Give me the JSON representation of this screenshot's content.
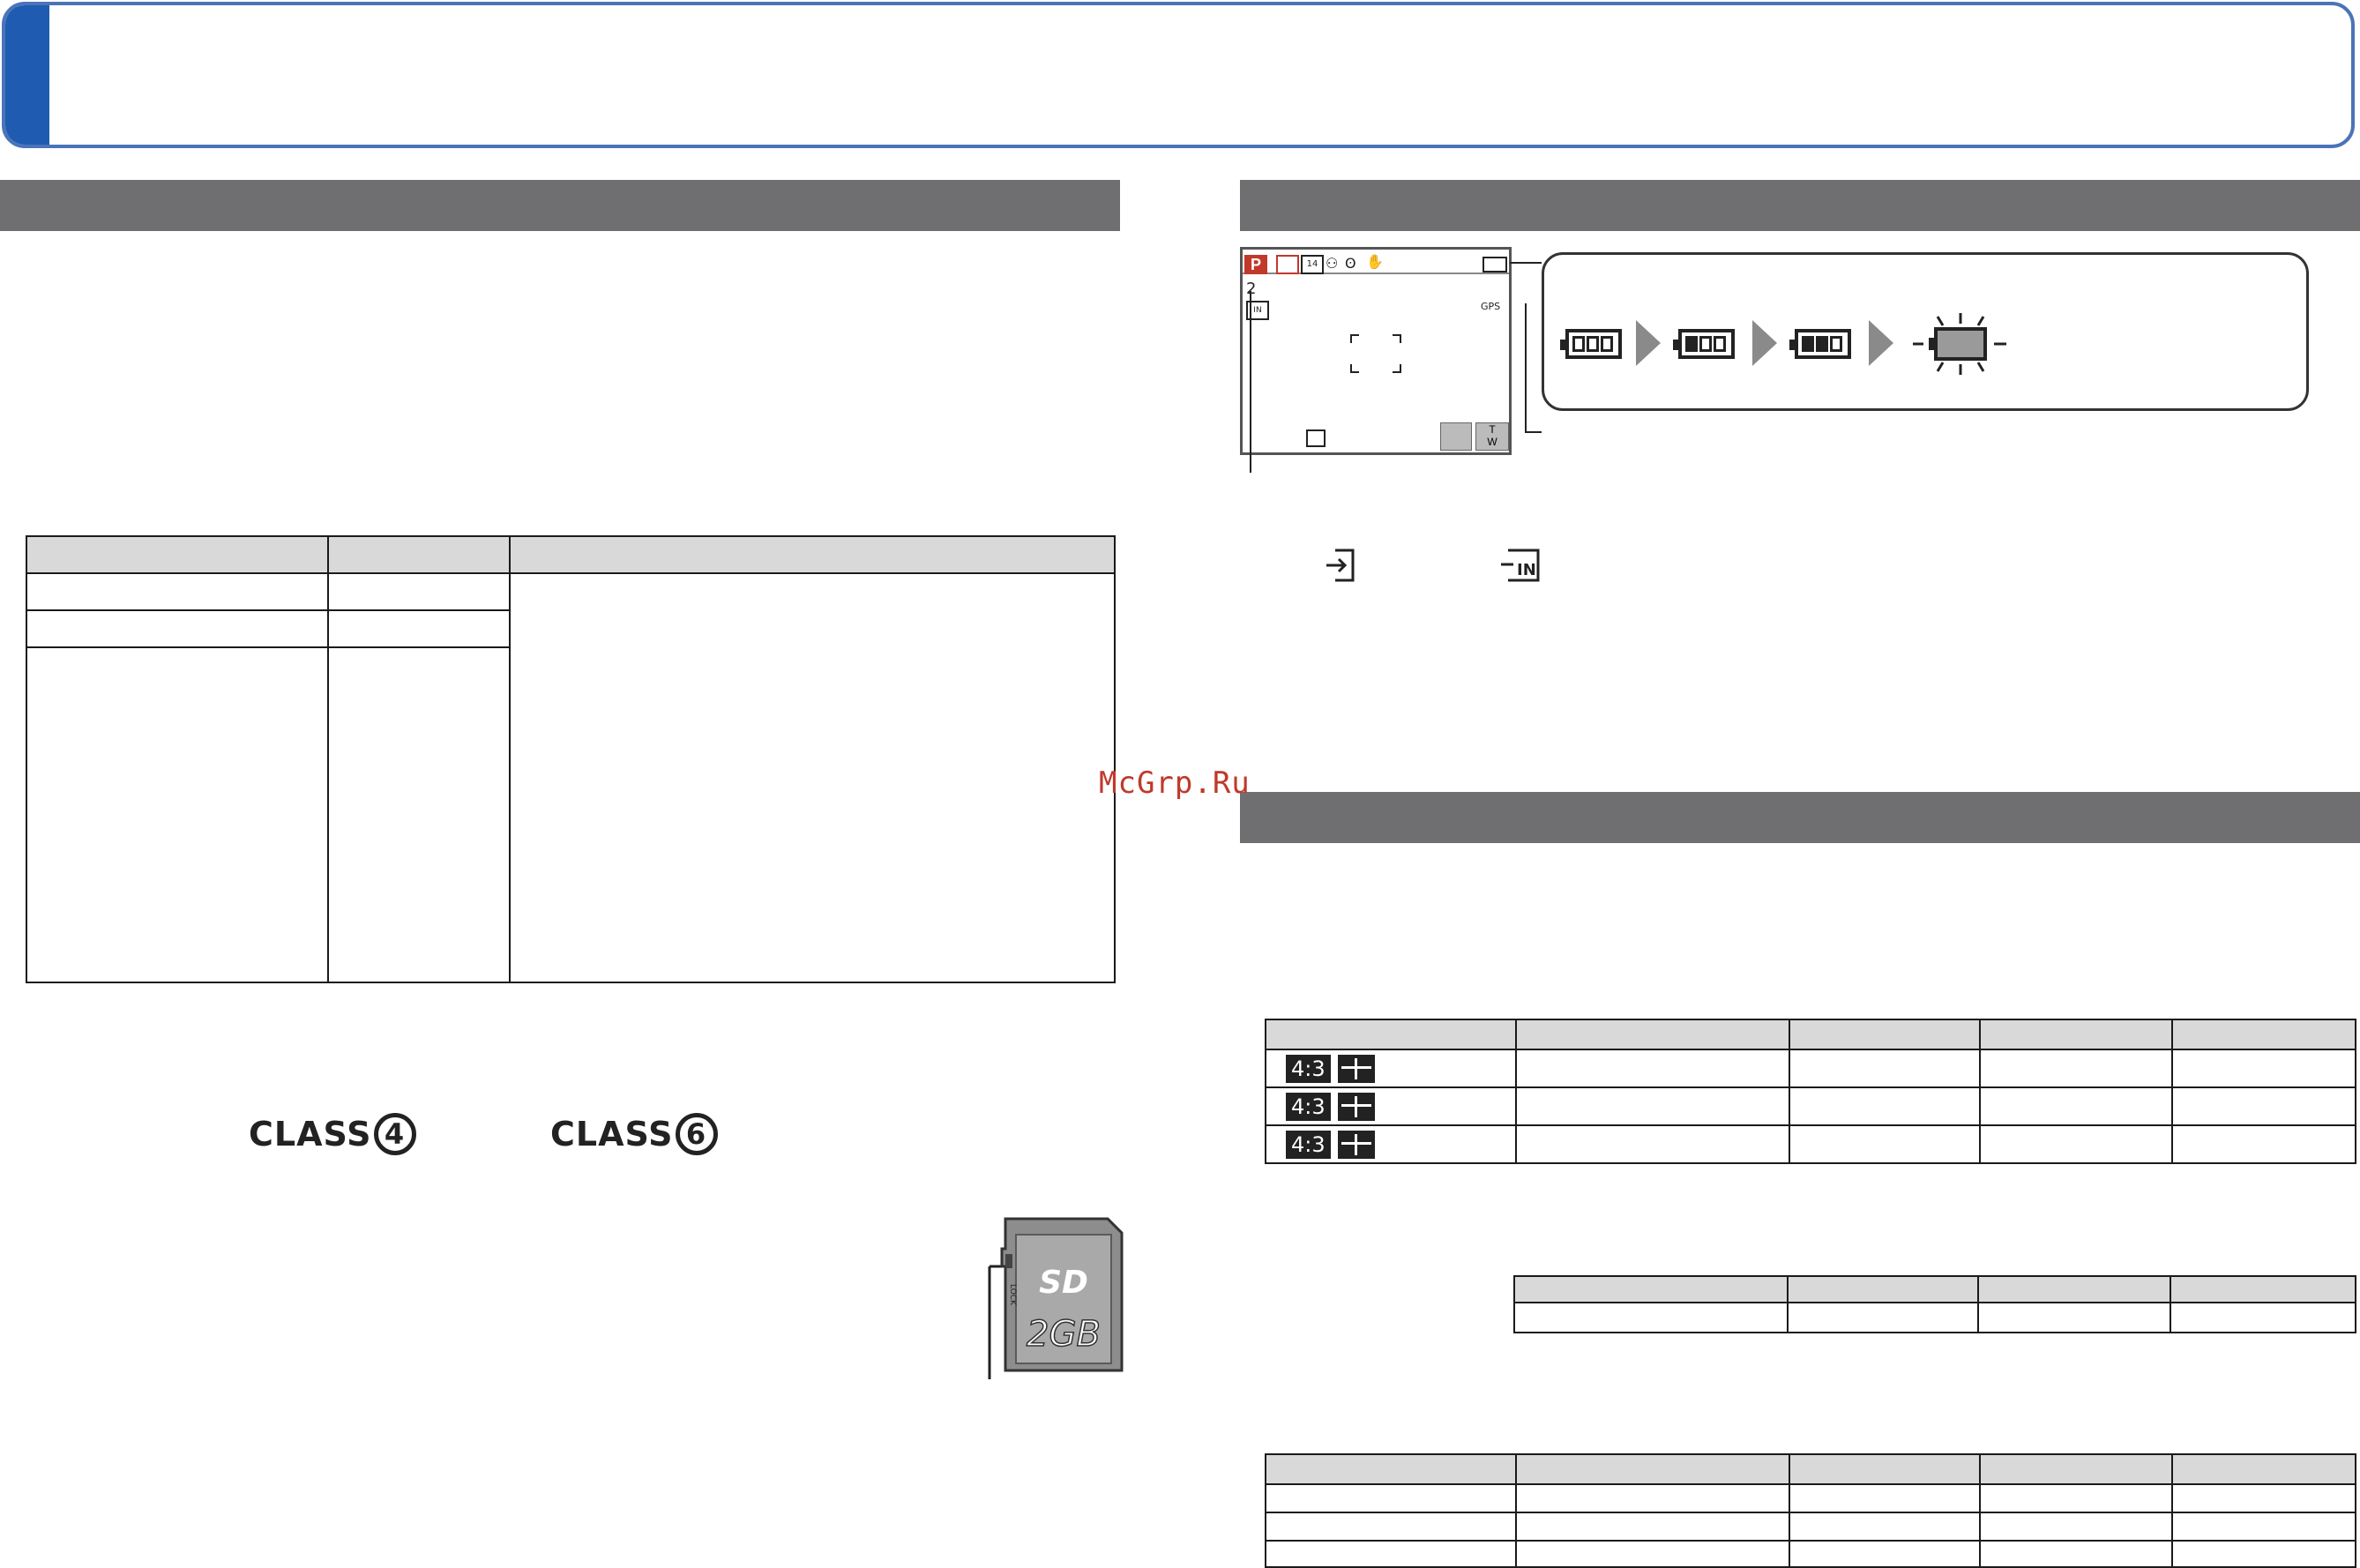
{
  "watermark": "McGrp.Ru",
  "class_logos": [
    {
      "word": "CLASS",
      "number": "4"
    },
    {
      "word": "CLASS",
      "number": "6"
    }
  ],
  "sd_card": {
    "brand": "SD",
    "capacity": "2GB",
    "lock_label": "LOCK"
  },
  "lcd": {
    "mode": "P",
    "remaining": "2",
    "icons": [
      "mode-p-icon",
      "movie-quality-icon",
      "size-14m-icon",
      "scene-icon",
      "af-icon",
      "stabilizer-icon",
      "battery-icon",
      "gps-icon",
      "memory-icon",
      "zoom-tw-icon"
    ]
  },
  "battery_levels": [
    "full",
    "partial",
    "low",
    "empty-blinking"
  ],
  "memory_icons": [
    "card-destination-icon",
    "built-in-memory-icon"
  ],
  "ratio_rows": [
    {
      "ratio": "4:3"
    },
    {
      "ratio": "4:3"
    },
    {
      "ratio": "4:3"
    }
  ],
  "colors": {
    "banner_border": "#4a74b8",
    "banner_accent": "#1f5bb0",
    "section_bar": "#6f6f71",
    "watermark": "#c0392b"
  }
}
